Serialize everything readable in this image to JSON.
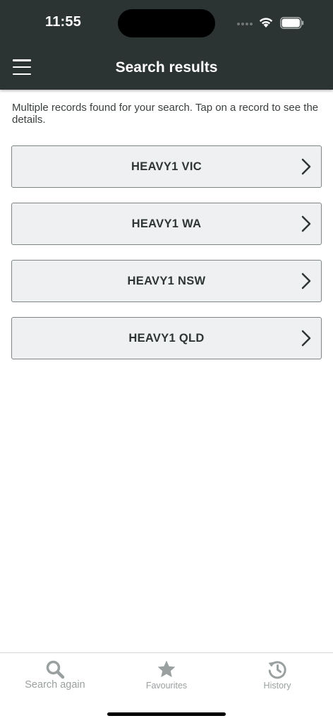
{
  "status_bar": {
    "time": "11:55"
  },
  "app_bar": {
    "title": "Search results",
    "menu_icon": "hamburger-menu-icon"
  },
  "intro_text": "Multiple records found for your search. Tap on a record to see the details.",
  "records": [
    {
      "label": "HEAVY1 VIC"
    },
    {
      "label": "HEAVY1 WA"
    },
    {
      "label": "HEAVY1 NSW"
    },
    {
      "label": "HEAVY1 QLD"
    }
  ],
  "bottom_nav": {
    "items": [
      {
        "label": "Search again",
        "icon": "search-icon"
      },
      {
        "label": "Favourites",
        "icon": "star-icon"
      },
      {
        "label": "History",
        "icon": "history-icon"
      }
    ]
  },
  "colors": {
    "header_bg": "#2b3433",
    "record_bg": "#eef0f1",
    "record_border": "#7f8585",
    "nav_inactive": "#9aa0a0"
  }
}
